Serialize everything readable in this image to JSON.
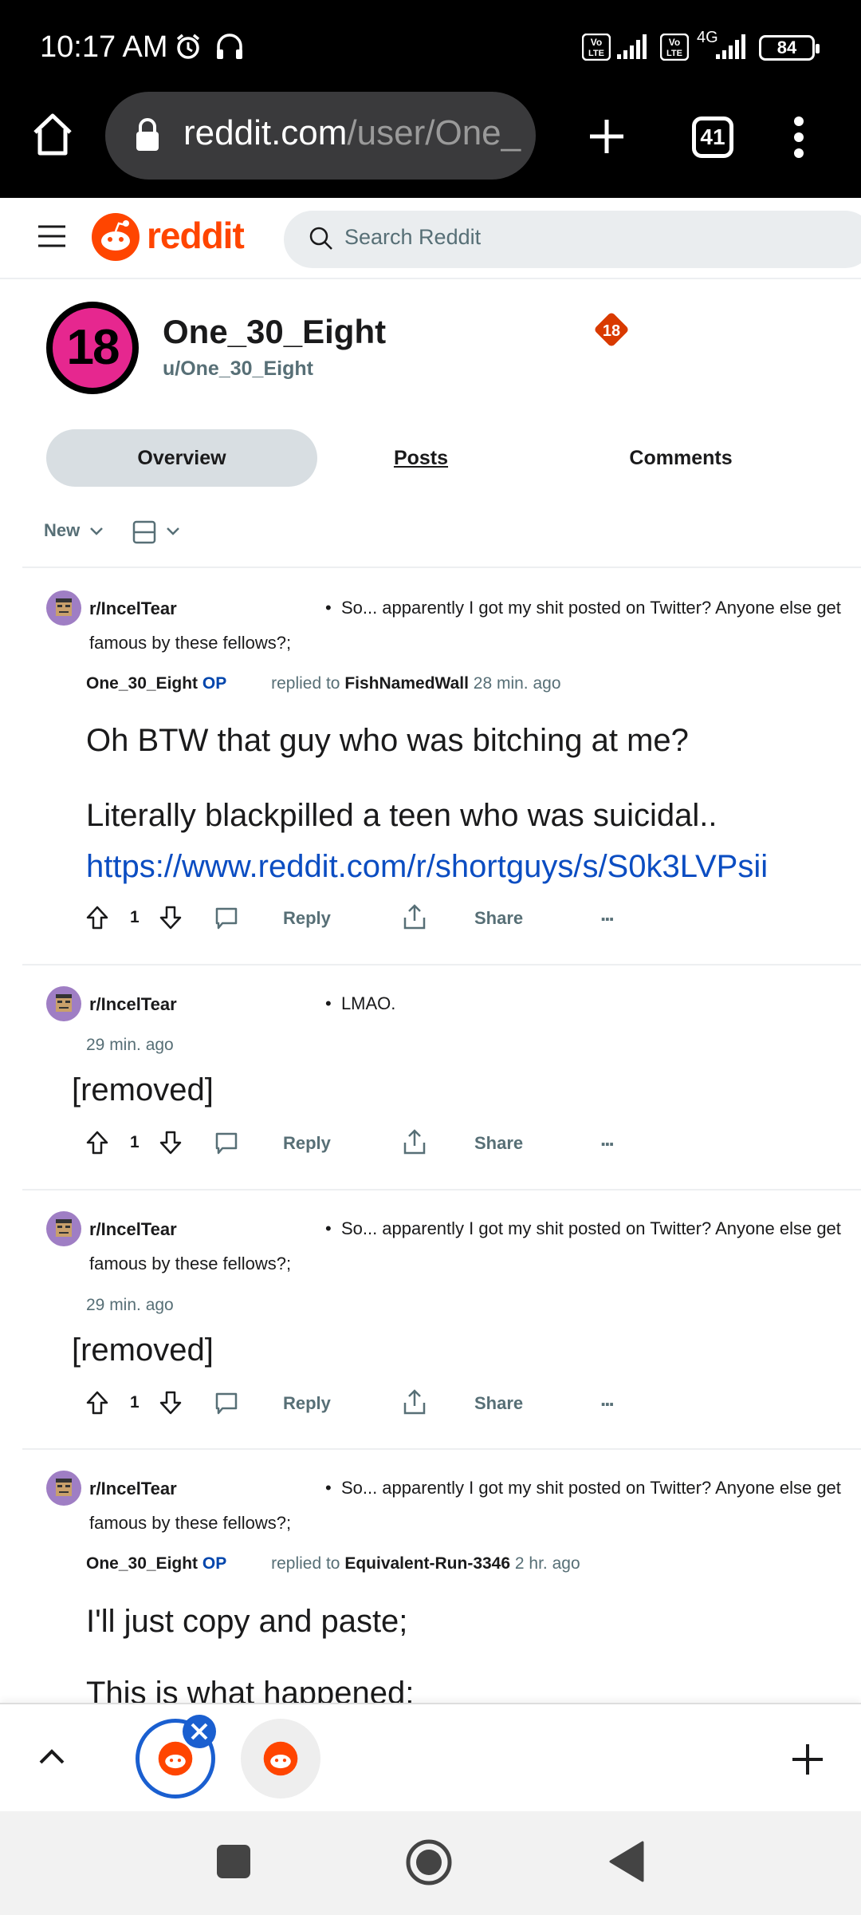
{
  "status_bar": {
    "time": "10:17 AM",
    "battery": "84",
    "network": "4G"
  },
  "browser": {
    "url_host": "reddit.com",
    "url_path": "/user/One_",
    "tab_count": "41"
  },
  "reddit_header": {
    "logo_text": "reddit",
    "search_placeholder": "Search Reddit"
  },
  "profile": {
    "avatar_text": "18",
    "display_name": "One_30_Eight",
    "handle": "u/One_30_Eight",
    "badge": "18"
  },
  "tabs": [
    {
      "label": "Overview"
    },
    {
      "label": "Posts"
    },
    {
      "label": "Comments"
    }
  ],
  "sort": {
    "label": "New"
  },
  "comments": [
    {
      "subreddit": "r/IncelTear",
      "post_title_1": "So... apparently I got my shit posted on Twitter? Anyone else get",
      "post_title_2": "famous by these fellows?;",
      "author": "One_30_Eight",
      "op": "OP",
      "replied_to": "replied to",
      "reply_user": "FishNamedWall",
      "time": "28 min. ago",
      "body_1": "Oh BTW that guy who was bitching at me?",
      "body_2": "Literally blackpilled a teen who was suicidal..",
      "body_link": "https://www.reddit.com/r/shortguys/s/S0k3LVPsii",
      "votes": "1",
      "reply_label": "Reply",
      "share_label": "Share",
      "more_label": "..."
    },
    {
      "subreddit": "r/IncelTear",
      "post_title_1": "LMAO.",
      "time": "29 min. ago",
      "body_1": "[removed]",
      "votes": "1",
      "reply_label": "Reply",
      "share_label": "Share",
      "more_label": "..."
    },
    {
      "subreddit": "r/IncelTear",
      "post_title_1": "So... apparently I got my shit posted on Twitter? Anyone else get",
      "post_title_2": "famous by these fellows?;",
      "time": "29 min. ago",
      "body_1": "[removed]",
      "votes": "1",
      "reply_label": "Reply",
      "share_label": "Share",
      "more_label": "..."
    },
    {
      "subreddit": "r/IncelTear",
      "post_title_1": "So... apparently I got my shit posted on Twitter? Anyone else get",
      "post_title_2": "famous by these fellows?;",
      "author": "One_30_Eight",
      "op": "OP",
      "replied_to": "replied to",
      "reply_user": "Equivalent-Run-3346",
      "time": "2 hr. ago",
      "body_1": "I'll just copy and paste;",
      "body_2": "This is what happened;"
    }
  ],
  "colors": {
    "reddit_orange": "#ff4500",
    "op_blue": "#0045ac",
    "link_blue": "#0b4dc2",
    "active_tab": "#d8dee2"
  }
}
